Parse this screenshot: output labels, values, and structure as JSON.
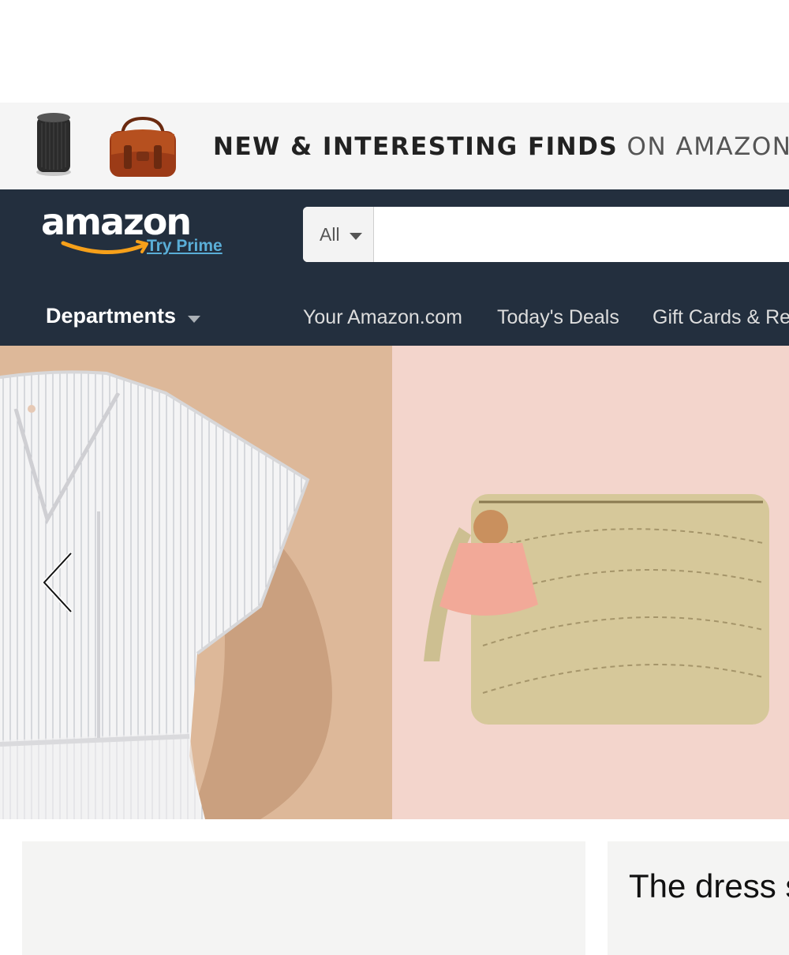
{
  "promo_banner": {
    "text_strong": "NEW & INTERESTING FINDS",
    "text_light": "ON AMAZON"
  },
  "header": {
    "logo_text": "amazon",
    "prime_link": "Try Prime",
    "search": {
      "scope_label": "All",
      "query": "",
      "placeholder": ""
    },
    "departments_label": "Departments",
    "nav_links": [
      "Your Amazon.com",
      "Today's Deals",
      "Gift Cards & Re"
    ]
  },
  "colors": {
    "header_bg": "#232f3e",
    "prime_link": "#5aaed7",
    "smile": "#f6a01a"
  },
  "icons": {
    "scope_caret": "caret-down-icon",
    "departments_caret": "caret-down-icon",
    "carousel_prev": "chevron-left-icon"
  },
  "cards": {
    "right_title": "The dress s"
  }
}
